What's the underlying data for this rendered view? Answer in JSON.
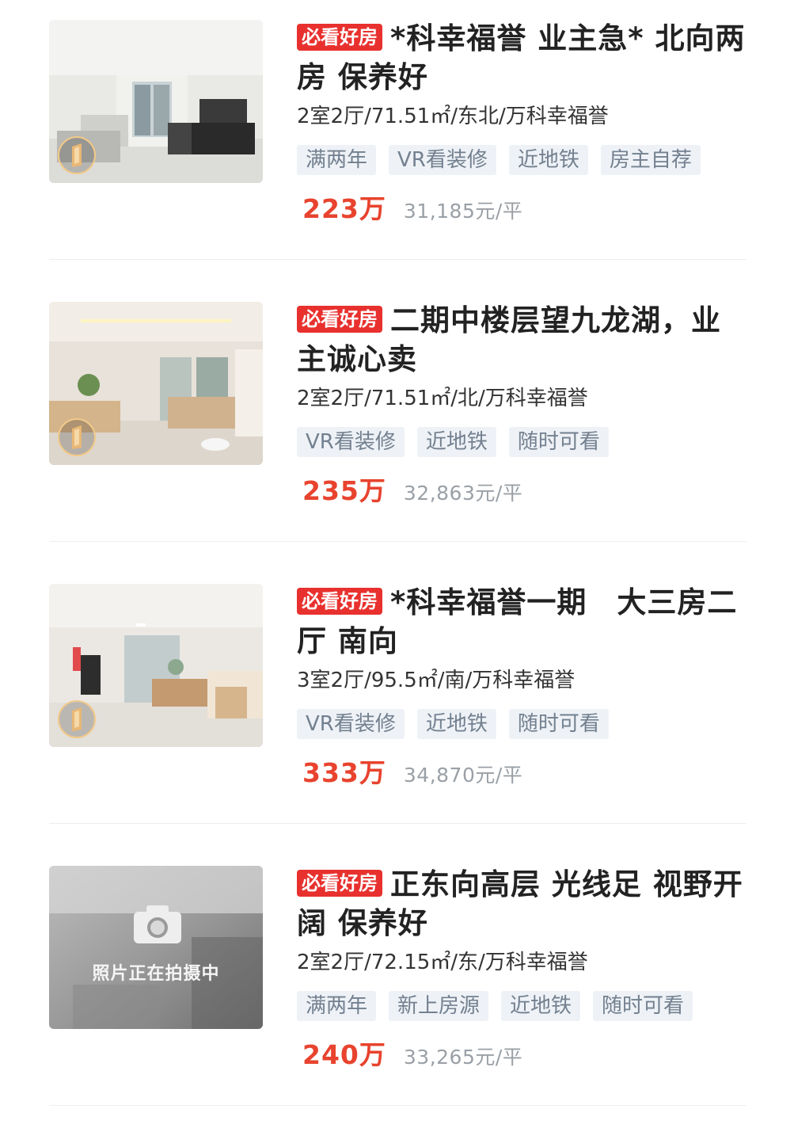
{
  "listings": [
    {
      "badge": "必看好房",
      "title": "*科幸福誉 业主急* 北向两房 保养好",
      "meta": "2室2厅/71.51㎡/东北/万科幸福誉",
      "tags": [
        "满两年",
        "VR看装修",
        "近地铁",
        "房主自荐"
      ],
      "price": "223万",
      "unit_price": "31,185元/平",
      "has_vr": true
    },
    {
      "badge": "必看好房",
      "title": "二期中楼层望九龙湖，业主诚心卖",
      "meta": "2室2厅/71.51㎡/北/万科幸福誉",
      "tags": [
        "VR看装修",
        "近地铁",
        "随时可看"
      ],
      "price": "235万",
      "unit_price": "32,863元/平",
      "has_vr": true
    },
    {
      "badge": "必看好房",
      "title": "*科幸福誉一期　大三房二厅 南向",
      "meta": "3室2厅/95.5㎡/南/万科幸福誉",
      "tags": [
        "VR看装修",
        "近地铁",
        "随时可看"
      ],
      "price": "333万",
      "unit_price": "34,870元/平",
      "has_vr": true
    },
    {
      "badge": "必看好房",
      "title": "正东向高层 光线足 视野开阔 保养好",
      "meta": "2室2厅/72.15㎡/东/万科幸福誉",
      "tags": [
        "满两年",
        "新上房源",
        "近地铁",
        "随时可看"
      ],
      "price": "240万",
      "unit_price": "33,265元/平",
      "has_vr": false,
      "photo_placeholder": "照片正在拍摄中"
    }
  ],
  "colors": {
    "badge_bg": "#e8312e",
    "price": "#e8432e",
    "tag_bg": "#eef2f7",
    "tag_text": "#73808f"
  }
}
